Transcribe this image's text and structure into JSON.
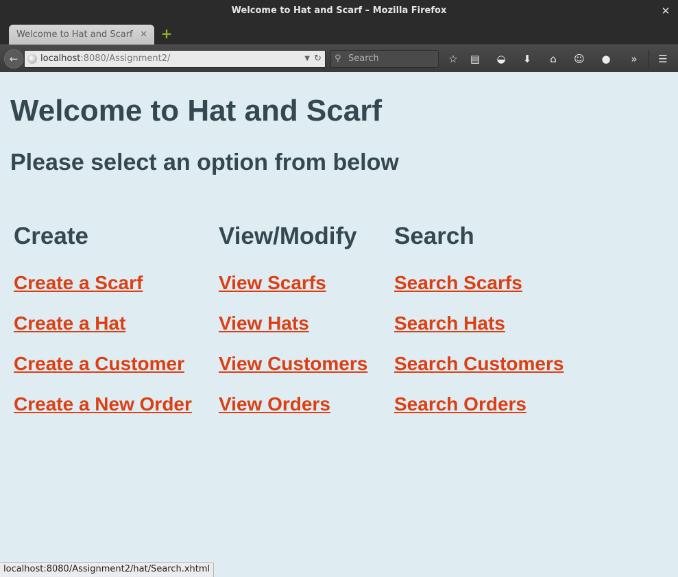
{
  "window": {
    "title": "Welcome to Hat and Scarf – Mozilla Firefox"
  },
  "tab": {
    "label": "Welcome to Hat and Scarf"
  },
  "navbar": {
    "url_host": "localhost",
    "url_path": ":8080/Assignment2/",
    "search_placeholder": "Search",
    "icons": [
      "back-arrow-icon",
      "globe-icon",
      "reload-icon",
      "search-icon",
      "bookmark-star-icon",
      "reading-list-icon",
      "pocket-icon",
      "downloads-icon",
      "home-icon",
      "chat-icon",
      "extension-icon",
      "overflow-icon",
      "menu-icon"
    ]
  },
  "page": {
    "title": "Welcome to Hat and Scarf",
    "subtitle": "Please select an option from below",
    "columns": [
      {
        "heading": "Create",
        "links": [
          "Create a Scarf",
          "Create a Hat",
          "Create a Customer",
          "Create a New Order"
        ]
      },
      {
        "heading": "View/Modify",
        "links": [
          "View Scarfs",
          "View Hats",
          "View Customers",
          "View Orders"
        ]
      },
      {
        "heading": "Search",
        "links": [
          "Search Scarfs",
          "Search Hats",
          "Search Customers",
          "Search Orders"
        ]
      }
    ]
  },
  "statusbar": {
    "text": "localhost:8080/Assignment2/hat/Search.xhtml"
  },
  "colors": {
    "page_background": "#dfecf2",
    "heading": "#33494f",
    "link": "#db3f13",
    "chrome_dark": "#2b2b2b"
  }
}
